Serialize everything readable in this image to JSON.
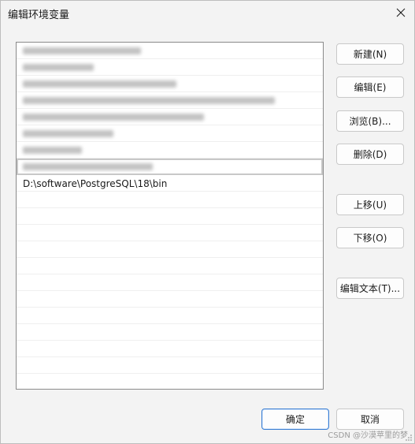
{
  "window": {
    "title": "编辑环境变量"
  },
  "list": {
    "visible_path": "D:\\software\\PostgreSQL\\18\\bin",
    "blurred_rows": 7,
    "empty_rows": 13
  },
  "buttons": {
    "new": "新建(N)",
    "edit": "编辑(E)",
    "browse": "浏览(B)...",
    "delete": "删除(D)",
    "move_up": "上移(U)",
    "move_down": "下移(O)",
    "edit_text": "编辑文本(T)...",
    "ok": "确定",
    "cancel": "取消"
  },
  "watermark": "CSDN @沙漠苹里的梦"
}
